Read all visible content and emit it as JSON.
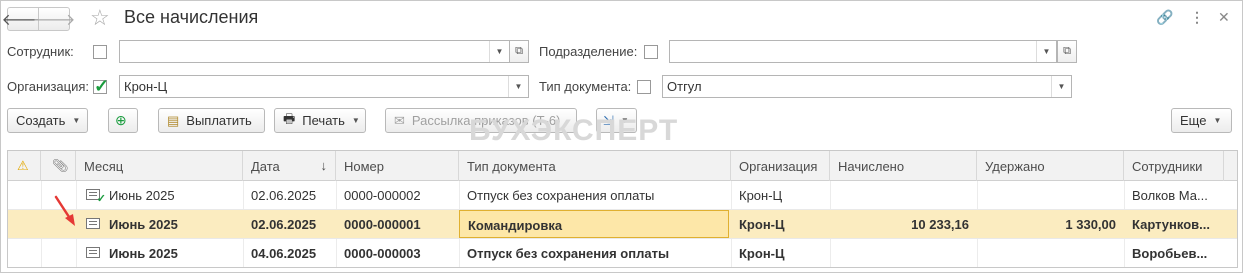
{
  "window": {
    "title": "Все начисления"
  },
  "filters": {
    "employee_label": "Сотрудник:",
    "employee_value": "",
    "department_label": "Подразделение:",
    "department_value": "",
    "organization_label": "Организация:",
    "organization_value": "Крон-Ц",
    "doctype_label": "Тип документа:",
    "doctype_value": "Отгул"
  },
  "toolbar": {
    "create_label": "Создать",
    "pay_label": "Выплатить",
    "print_label": "Печать",
    "mailing_label": "Рассылка приказов (Т-6)",
    "more_label": "Еще"
  },
  "watermark": "БУХЭКСПЕРТ",
  "table": {
    "headers": {
      "month": "Месяц",
      "date": "Дата",
      "number": "Номер",
      "doc_type": "Тип документа",
      "organization": "Организация",
      "accrued": "Начислено",
      "withheld": "Удержано",
      "employees": "Сотрудники"
    },
    "sort_indicator": "↓",
    "rows": [
      {
        "month": "Июнь 2025",
        "date": "02.06.2025",
        "number": "0000-000002",
        "doc_type": "Отпуск без сохранения оплаты",
        "organization": "Крон-Ц",
        "accrued": "",
        "withheld": "",
        "employees": "Волков Ма..."
      },
      {
        "month": "Июнь 2025",
        "date": "02.06.2025",
        "number": "0000-000001",
        "doc_type": "Командировка",
        "organization": "Крон-Ц",
        "accrued": "10 233,16",
        "withheld": "1 330,00",
        "employees": "Картунков..."
      },
      {
        "month": "Июнь 2025",
        "date": "04.06.2025",
        "number": "0000-000003",
        "doc_type": "Отпуск без сохранения оплаты",
        "organization": "Крон-Ц",
        "accrued": "",
        "withheld": "",
        "employees": "Воробьев..."
      }
    ]
  },
  "colors": {
    "selected_row": "#fbecc0",
    "focus_cell": "#fde7a8",
    "check": "#1a9c3e",
    "arrow": "#e53935"
  }
}
